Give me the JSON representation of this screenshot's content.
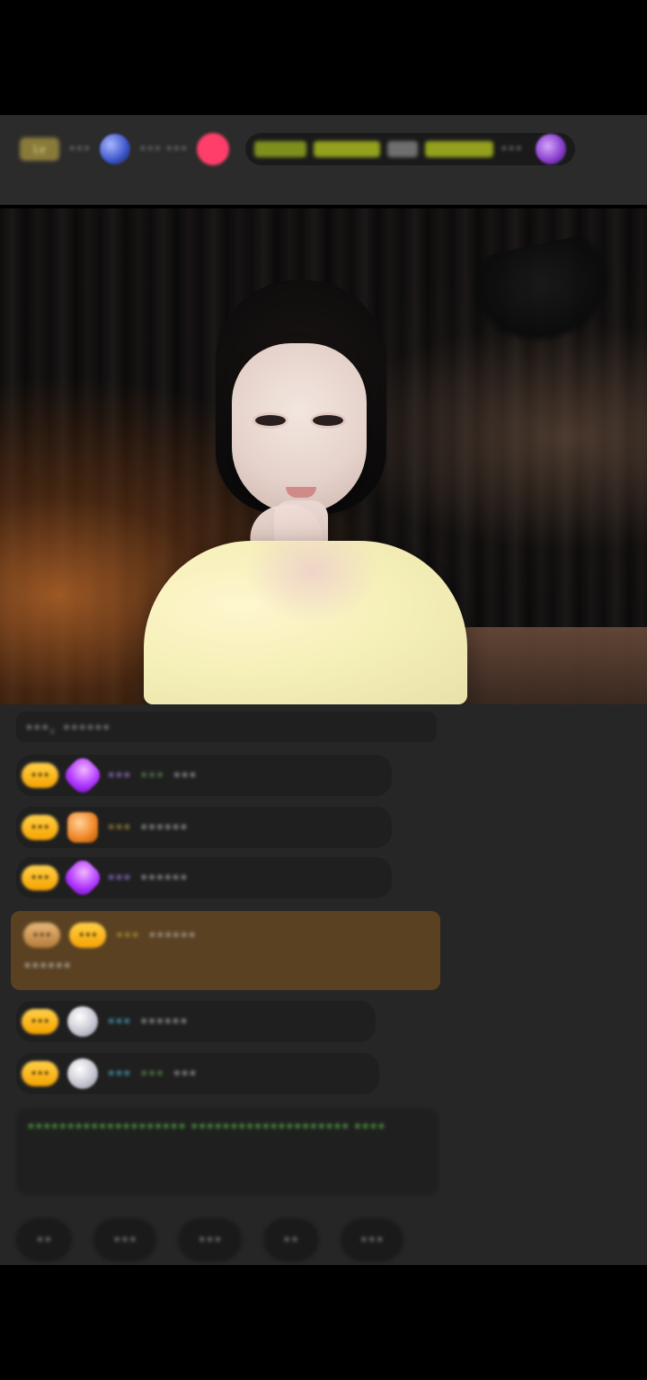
{
  "top_bar": {
    "level_badge": "Lv",
    "anchor_text": "•••",
    "viewer_text": "•••  •••",
    "rank_segments": [
      "•••",
      "•••",
      "•••",
      "•••"
    ],
    "more": "•••"
  },
  "chat": {
    "notice": "•••，••••••",
    "items": [
      {
        "pill": "•••",
        "badge": "gem",
        "name": "•••",
        "extra": "•••",
        "message": "•••"
      },
      {
        "pill": "•••",
        "badge": "orange",
        "name": "•••",
        "extra": "",
        "message": "••••••"
      },
      {
        "pill": "•••",
        "badge": "gem",
        "name": "•••",
        "extra": "",
        "message": "••••••"
      },
      {
        "pill": "•••",
        "badge": "gray",
        "name": "•••",
        "extra": "",
        "message": "••••••"
      },
      {
        "pill": "•••",
        "badge": "gray",
        "name": "•••",
        "extra": "•••",
        "message": "•••"
      }
    ],
    "highlight": {
      "left_pill": "•••",
      "right_pill": "•••",
      "name": "•••",
      "message_line1": "••••••",
      "message_line2": "••••••"
    },
    "green_message": "••••••••••••••••••••\n••••••••••••••••••••\n••••"
  },
  "suggestions": [
    "••",
    "•••",
    "•••",
    "••",
    "•••"
  ]
}
